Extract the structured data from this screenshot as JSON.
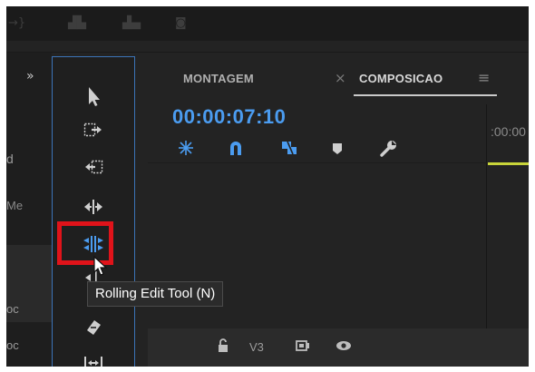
{
  "left_panel": {
    "expand_glyph": "»",
    "labels": [
      "d",
      "Me",
      "oc",
      "oc"
    ]
  },
  "tools": [
    {
      "name": "selection-tool",
      "icon": "arrow-icon"
    },
    {
      "name": "track-select-forward-tool",
      "icon": "track-select-forward-icon"
    },
    {
      "name": "track-select-backward-tool",
      "icon": "track-select-backward-icon"
    },
    {
      "name": "ripple-edit-tool",
      "icon": "ripple-edit-icon"
    },
    {
      "name": "rolling-edit-tool",
      "icon": "rolling-edit-icon",
      "active": true
    },
    {
      "name": "rate-stretch-tool",
      "icon": "rate-stretch-icon"
    },
    {
      "name": "razor-tool",
      "icon": "razor-icon"
    },
    {
      "name": "slip-tool",
      "icon": "slip-icon"
    }
  ],
  "tooltip": "Rolling Edit Tool (N)",
  "timeline": {
    "tabs": [
      {
        "label": "MONTAGEM",
        "active": false
      },
      {
        "label": "COMPOSICAO",
        "active": true
      }
    ],
    "close_glyph": "×",
    "menu_glyph": "≡",
    "timecode": "00:00:07:10",
    "ruler_label": ":00:00",
    "track_label": "V3"
  },
  "colors": {
    "accent_blue": "#4b9cf0",
    "highlight_red": "#e0131a",
    "playhead_yellow": "#c8d43a",
    "panel_border": "#3c74b8"
  }
}
